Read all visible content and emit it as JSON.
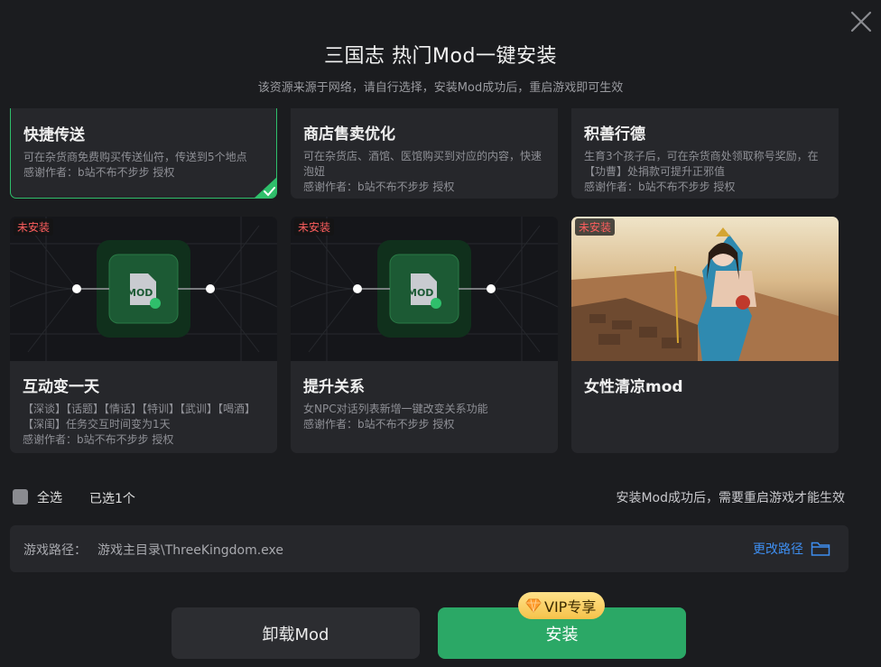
{
  "header": {
    "title": "三国志 热门Mod一键安装",
    "subtitle": "该资源来源于网络，请自行选择，安装Mod成功后，重启游戏即可生效"
  },
  "mods": [
    {
      "title": "快捷传送",
      "desc": "可在杂货商免费购买传送仙符，传送到5个地点",
      "credit": "感谢作者：b站不布不步步 授权",
      "selected": true
    },
    {
      "title": "商店售卖优化",
      "desc": "可在杂货店、酒馆、医馆购买到对应的内容，快速泡妞",
      "credit": "感谢作者：b站不布不步步 授权",
      "selected": false
    },
    {
      "title": "积善行德",
      "desc": "生育3个孩子后，可在杂货商处领取称号奖励，在【功曹】处捐款可提升正邪值",
      "credit": "感谢作者：b站不布不步步 授权",
      "selected": false
    },
    {
      "title": "互动变一天",
      "desc": "【深谈】【话题】【情话】【特训】【武训】【喝酒】【深闺】任务交互时间变为1天",
      "credit": "感谢作者：b站不布不步步 授权",
      "badge": "未安装",
      "thumb_icon": "mod-file-icon"
    },
    {
      "title": "提升关系",
      "desc": "女NPC对话列表新增一键改变关系功能",
      "credit": "感谢作者：b站不布不步步 授权",
      "badge": "未安装",
      "thumb_icon": "mod-file-icon"
    },
    {
      "title": "女性清凉mod",
      "desc": "",
      "credit": "",
      "badge": "未安装",
      "thumb_icon": "character-illustration"
    }
  ],
  "mod_icon_text": "MOD",
  "footer": {
    "select_all": "全选",
    "selected_count": "已选1个",
    "restart_note": "安装Mod成功后，需要重启游戏才能生效"
  },
  "path": {
    "label": "游戏路径：",
    "value": "游戏主目录\\ThreeKingdom.exe",
    "change_label": "更改路径"
  },
  "buttons": {
    "uninstall": "卸载Mod",
    "install": "安装",
    "vip": "VIP专享"
  },
  "colors": {
    "accent_green": "#2ba866",
    "selected_border": "#2fbf6b",
    "link_blue": "#3e8ef0",
    "badge_red": "#ff5e5e",
    "vip_gold": "#f6c24a"
  }
}
